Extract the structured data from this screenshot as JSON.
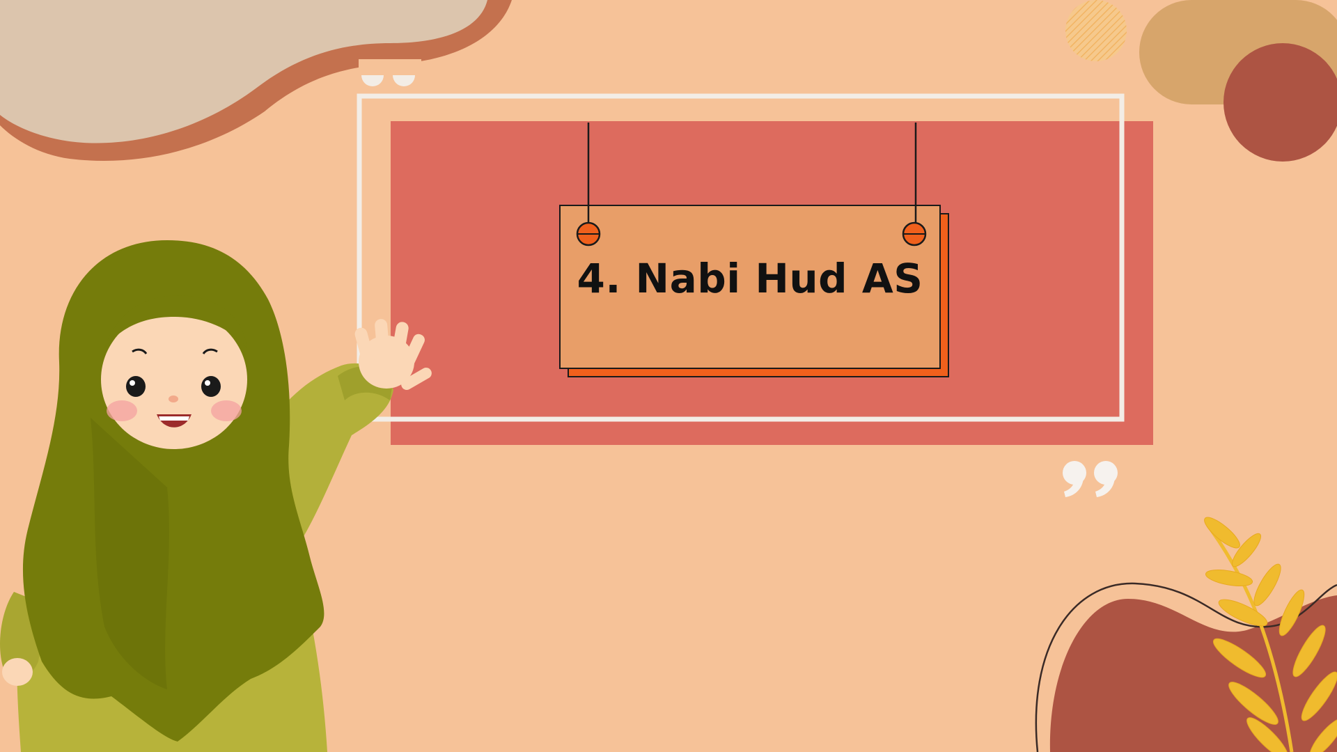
{
  "slide": {
    "title": "4. Nabi Hud AS"
  },
  "colors": {
    "background": "#f6c298",
    "panel": "#dd6b5e",
    "frame": "#f3ede6",
    "sign_board": "#e89e68",
    "sign_shadow": "#f0601c",
    "blob_maroon": "#ad5443",
    "blob_tan": "#d7a56b",
    "blob_beige": "#dcc5ad",
    "blob_rust": "#c4714e",
    "leaf_yellow": "#f0bb2e",
    "hijab_green": "#757c0b",
    "dress_green": "#b7b33a",
    "skin": "#fbd7b6"
  },
  "decor": {
    "character": "girl-in-green-hijab-waving",
    "quote_marks": "closing-quote-icon",
    "plant": "yellow-leaf-branch"
  }
}
